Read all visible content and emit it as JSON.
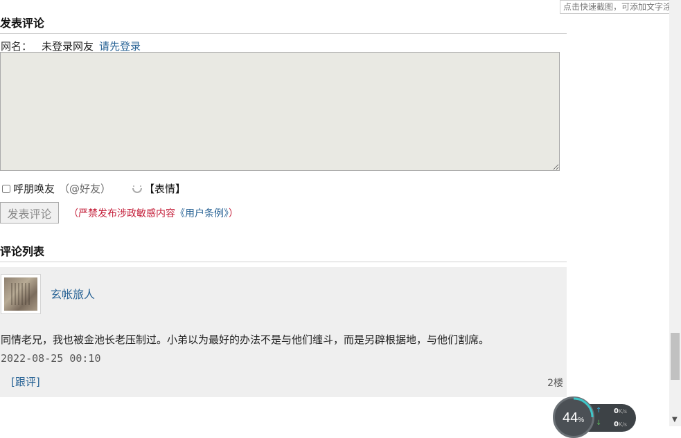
{
  "post_comment": {
    "title": "发表评论",
    "name_label": "网名：",
    "guest_name": "未登录网友",
    "login_link": "请先登录",
    "mention_label": "呼朋唤友",
    "mention_hint": "（@好友）",
    "emoji_label": "【表情】",
    "submit_label": "发表评论",
    "notice_prefix": "（严禁发布涉政敏感内容",
    "notice_link": "《用户条例》",
    "notice_suffix": "）"
  },
  "comment_list": {
    "title": "评论列表",
    "comments": [
      {
        "username": "玄帐旅人",
        "text": "同情老兄，我也被金池长老压制过。小弟以为最好的办法不是与他们缠斗，而是另辟根据地，与他们割席。",
        "time": "2022-08-25 00:10",
        "reply_label": "[跟评]",
        "floor": "2楼"
      }
    ]
  },
  "tooltip": {
    "text": "点击快速截图，可添加文字涂鸦"
  },
  "speed_widget": {
    "percent": "44",
    "percent_unit": "%",
    "upload_value": "0",
    "upload_unit": "K/s",
    "download_value": "0",
    "download_unit": "K/s"
  },
  "colors": {
    "link": "#2a6496",
    "notice": "#c41f3a",
    "textarea_bg": "#e9e9e3",
    "card_bg": "#efefef"
  }
}
